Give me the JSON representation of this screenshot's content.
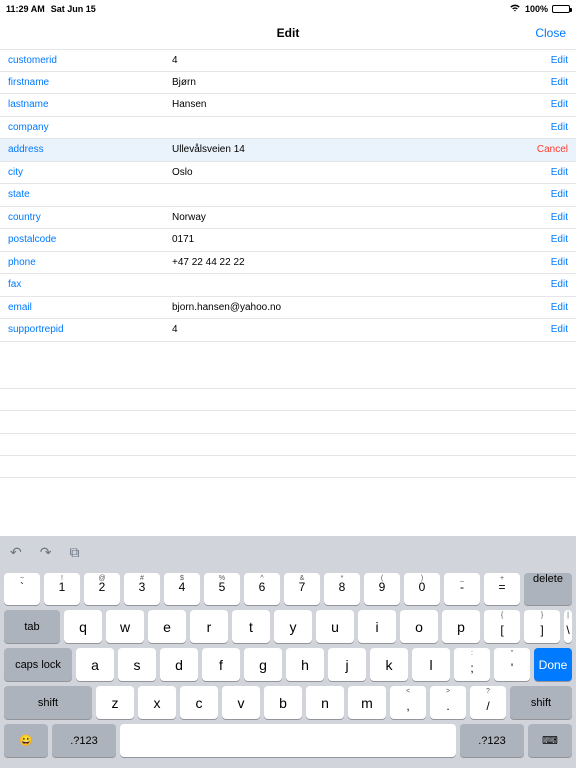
{
  "status": {
    "time": "11:29 AM",
    "date": "Sat Jun 15",
    "battery": "100%",
    "wifi": "􀙇"
  },
  "nav": {
    "title": "Edit",
    "close": "Close"
  },
  "actions": {
    "edit": "Edit",
    "cancel": "Cancel"
  },
  "rows": [
    {
      "field": "customerid",
      "value": "4",
      "editing": false
    },
    {
      "field": "firstname",
      "value": "Bjørn",
      "editing": false
    },
    {
      "field": "lastname",
      "value": "Hansen",
      "editing": false
    },
    {
      "field": "company",
      "value": "",
      "editing": false
    },
    {
      "field": "address",
      "value": "Ullevålsveien 14",
      "editing": true
    },
    {
      "field": "city",
      "value": "Oslo",
      "editing": false
    },
    {
      "field": "state",
      "value": "",
      "editing": false
    },
    {
      "field": "country",
      "value": "Norway",
      "editing": false
    },
    {
      "field": "postalcode",
      "value": "0171",
      "editing": false
    },
    {
      "field": "phone",
      "value": "+47 22 44 22 22",
      "editing": false
    },
    {
      "field": "fax",
      "value": "",
      "editing": false
    },
    {
      "field": "email",
      "value": "bjorn.hansen@yahoo.no",
      "editing": false
    },
    {
      "field": "supportrepid",
      "value": "4",
      "editing": false
    }
  ],
  "keyboard": {
    "toolbar": {
      "undo": "↶",
      "redo": "↷",
      "paste": "⧉"
    },
    "numrow": [
      {
        "sup": "~",
        "main": "`"
      },
      {
        "sup": "!",
        "main": "1"
      },
      {
        "sup": "@",
        "main": "2"
      },
      {
        "sup": "#",
        "main": "3"
      },
      {
        "sup": "$",
        "main": "4"
      },
      {
        "sup": "%",
        "main": "5"
      },
      {
        "sup": "^",
        "main": "6"
      },
      {
        "sup": "&",
        "main": "7"
      },
      {
        "sup": "*",
        "main": "8"
      },
      {
        "sup": "(",
        "main": "9"
      },
      {
        "sup": ")",
        "main": "0"
      },
      {
        "sup": "_",
        "main": "-"
      },
      {
        "sup": "+",
        "main": "="
      }
    ],
    "delete": "delete",
    "row2": {
      "tab": "tab",
      "keys": [
        "q",
        "w",
        "e",
        "r",
        "t",
        "y",
        "u",
        "i",
        "o",
        "p"
      ],
      "br1": {
        "sup": "{",
        "main": "["
      },
      "br2": {
        "sup": "}",
        "main": "]"
      },
      "bs": {
        "sup": "|",
        "main": "\\"
      }
    },
    "row3": {
      "caps": "caps lock",
      "keys": [
        "a",
        "s",
        "d",
        "f",
        "g",
        "h",
        "j",
        "k",
        "l"
      ],
      "sc": {
        "sup": ":",
        "main": ";"
      },
      "qt": {
        "sup": "\"",
        "main": "'"
      },
      "done": "Done"
    },
    "row4": {
      "shiftL": "shift",
      "keys": [
        "z",
        "x",
        "c",
        "v",
        "b",
        "n",
        "m"
      ],
      "cm": {
        "sup": "<",
        "main": ","
      },
      "pd": {
        "sup": ">",
        "main": "."
      },
      "sl": {
        "sup": "?",
        "main": "/"
      },
      "shiftR": "shift"
    },
    "row5": {
      "emoji": "😀",
      "numL": ".?123",
      "space": " ",
      "numR": ".?123",
      "hide": "⌨"
    }
  }
}
